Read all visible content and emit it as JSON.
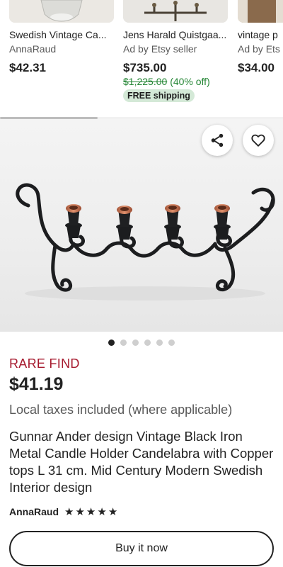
{
  "related_listings": [
    {
      "title": "Swedish Vintage Ca...",
      "seller": "AnnaRaud",
      "price": "$42.31"
    },
    {
      "title": "Jens Harald Quistgaa...",
      "seller": "Ad by Etsy seller",
      "price": "$735.00",
      "original_price": "$1,225.00",
      "discount": "(40% off)",
      "shipping_badge": "FREE shipping"
    },
    {
      "title": "vintage p",
      "seller": "Ad by Ets",
      "price": "$34.00"
    }
  ],
  "listing": {
    "badge": "RARE FIND",
    "price": "$41.19",
    "tax_note": "Local taxes included (where applicable)",
    "title": "Gunnar Ander design Vintage Black Iron Metal Candle Holder Candelabra with Copper tops L 31 cm. Mid Century Modern Swedish Interior design",
    "seller": "AnnaRaud",
    "rating": 5,
    "rating_max": 5,
    "image_count": 6,
    "active_image": 1,
    "buy_label": "Buy it now"
  },
  "icons": {
    "share": "share-icon",
    "favorite": "heart-icon",
    "star": "star-icon"
  },
  "colors": {
    "rare_find": "#a61a2e",
    "discount_green": "#258635",
    "shipping_badge_bg": "#d4e9d7"
  }
}
